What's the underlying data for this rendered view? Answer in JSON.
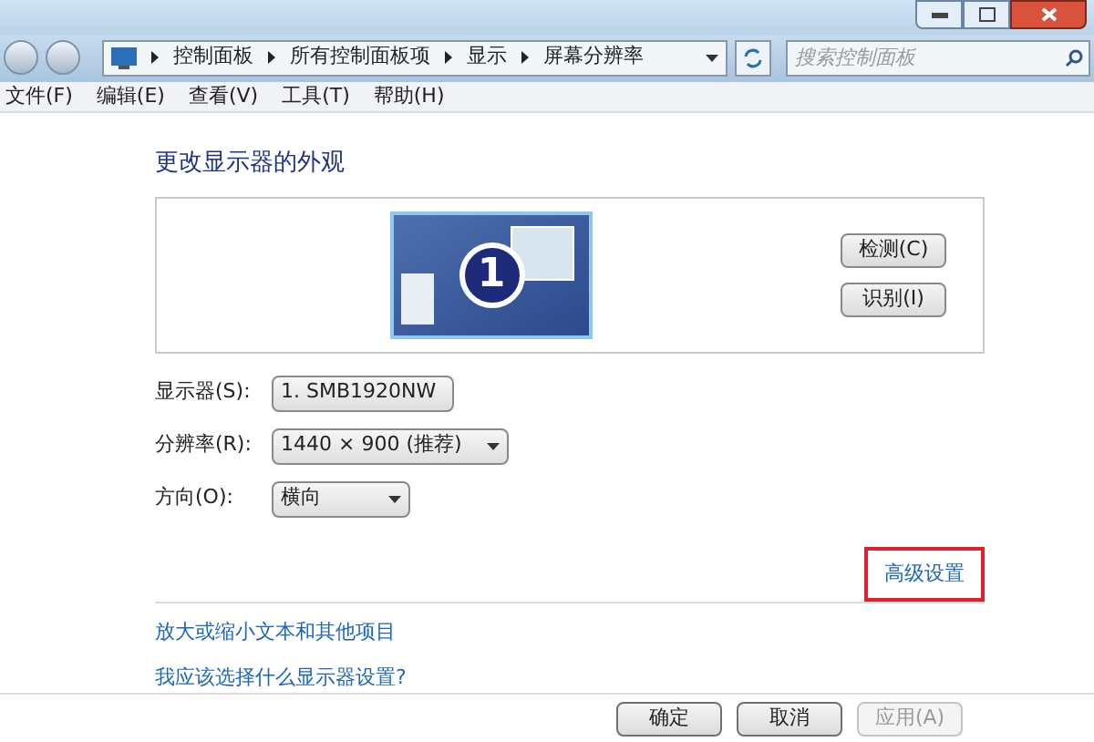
{
  "address_bar": {
    "crumbs": [
      "控制面板",
      "所有控制面板项",
      "显示",
      "屏幕分辨率"
    ]
  },
  "search": {
    "placeholder": "搜索控制面板"
  },
  "menu": [
    "文件(F)",
    "编辑(E)",
    "查看(V)",
    "工具(T)",
    "帮助(H)"
  ],
  "heading": "更改显示器的外观",
  "preview": {
    "monitor_number": "1",
    "buttons": [
      "检测(C)",
      "识别(I)"
    ]
  },
  "settings": [
    {
      "label": "显示器(S):",
      "value": "1. SMB1920NW"
    },
    {
      "label": "分辨率(R):",
      "value": "1440 × 900 (推荐)"
    },
    {
      "label": "方向(O):",
      "value": "横向"
    }
  ],
  "advanced_link": {
    "text": "高级设置",
    "highlighted": true
  },
  "links": [
    "放大或缩小文本和其他项目",
    "我应该选择什么显示器设置?"
  ],
  "buttons": [
    {
      "label": "确定",
      "disabled": false
    },
    {
      "label": "取消",
      "disabled": false
    },
    {
      "label": "应用(A)",
      "disabled": true
    }
  ]
}
